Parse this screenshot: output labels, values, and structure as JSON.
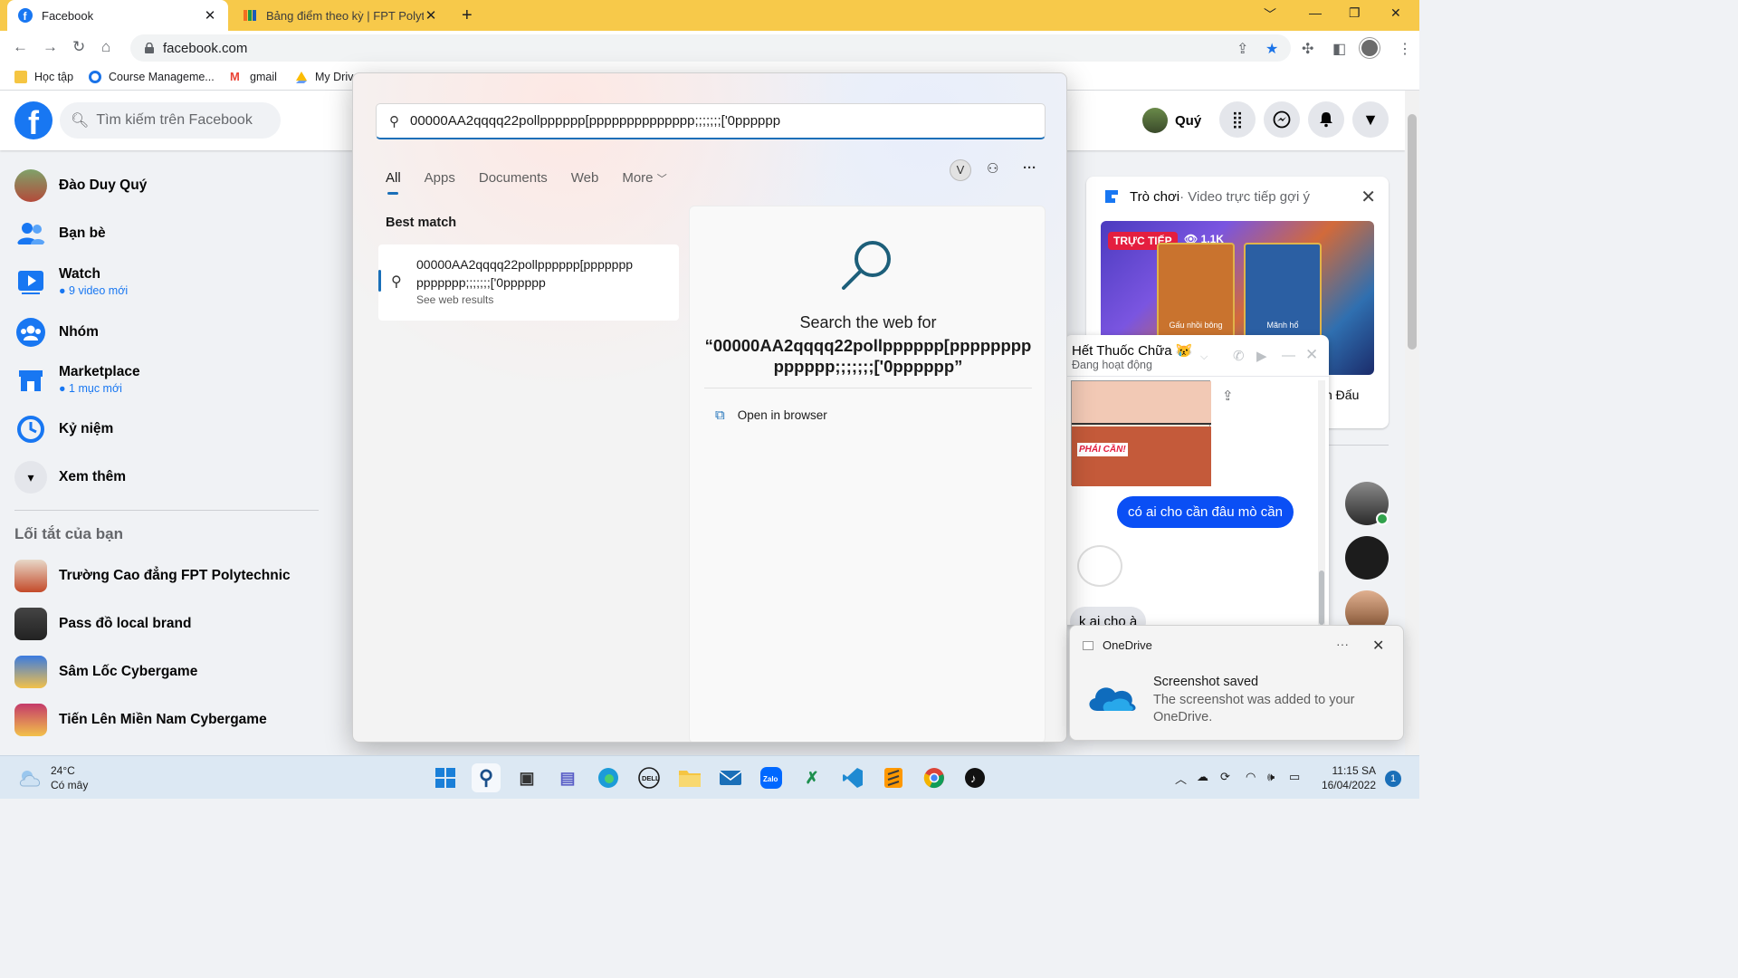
{
  "browser": {
    "tabs": [
      {
        "title": "Facebook",
        "active": true
      },
      {
        "title": "Bảng điểm theo kỳ | FPT Polytech",
        "active": false
      }
    ],
    "url": "facebook.com",
    "bookmarks": [
      "Học tập",
      "Course Manageme...",
      "gmail",
      "My Driv"
    ]
  },
  "facebook": {
    "search_placeholder": "Tìm kiếm trên Facebook",
    "profile_name": "Quý",
    "nav": [
      {
        "label": "Đào Duy Quý",
        "sub": ""
      },
      {
        "label": "Bạn bè",
        "sub": ""
      },
      {
        "label": "Watch",
        "sub": "9 video mới"
      },
      {
        "label": "Nhóm",
        "sub": ""
      },
      {
        "label": "Marketplace",
        "sub": "1 mục mới"
      },
      {
        "label": "Kỷ niệm",
        "sub": ""
      },
      {
        "label": "Xem thêm",
        "sub": ""
      }
    ],
    "shortcuts_title": "Lối tắt của bạn",
    "shortcuts": [
      "Trường Cao đẳng FPT Polytechnic",
      "Pass đồ local brand",
      "Sâm Lốc Cybergame",
      "Tiến Lên Miền Nam Cybergame"
    ],
    "games_card": {
      "title": "Trò chơi",
      "subtitle": " · Video trực tiếp gợi ý",
      "live_badge": "TRỰC TIẾP",
      "viewers": "1,1K",
      "tile_labels": [
        "Gấu nhồi bông",
        "Mãnh hổ"
      ],
      "footer_fragment": "n Đấu"
    },
    "chat": {
      "name": "Hết Thuốc Chữa 😿",
      "status": "Đang hoạt động",
      "sticker_caption": "PHẢI CẦN!",
      "outgoing": "có ai cho cần đâu mò cần",
      "incoming": "k ai cho à"
    }
  },
  "win_search": {
    "query": "00000AA2qqqq22pollpppppp[pppppppppppppp;;;;;;;['0pppppp",
    "tabs": [
      "All",
      "Apps",
      "Documents",
      "Web",
      "More"
    ],
    "avatar_letter": "V",
    "best_match_title": "Best match",
    "best_match_text": "00000AA2qqqq22pollpppppp[pppppppppppppp;;;;;;;['0pppppp",
    "best_match_sub": "See web results",
    "detail_title": "Search the web for",
    "detail_query": "“00000AA2qqqq22pollpppppp[pppppppppppppp;;;;;;;['0pppppp”",
    "open_in_browser": "Open in browser"
  },
  "toast": {
    "app": "OneDrive",
    "title": "Screenshot saved",
    "body": "The screenshot was added to your OneDrive."
  },
  "taskbar": {
    "temp": "24°C",
    "weather": "Có mây",
    "time": "11:15 SA",
    "date": "16/04/2022",
    "notifications": "1",
    "apps": [
      "start-icon",
      "search-icon",
      "task-view-icon",
      "teams-icon",
      "edge-icon",
      "dell-icon",
      "file-explorer-icon",
      "mail-icon",
      "zalo-icon",
      "excel-icon",
      "vscode-icon",
      "sublime-icon",
      "chrome-icon",
      "tiktok-icon"
    ]
  },
  "colors": {
    "chrome_titlebar": "#f7c94a",
    "facebook_blue": "#1877f2",
    "messenger_bubble": "#0a4ff5",
    "windows_accent": "#1a6fb8",
    "live_red": "#e41e3f"
  }
}
